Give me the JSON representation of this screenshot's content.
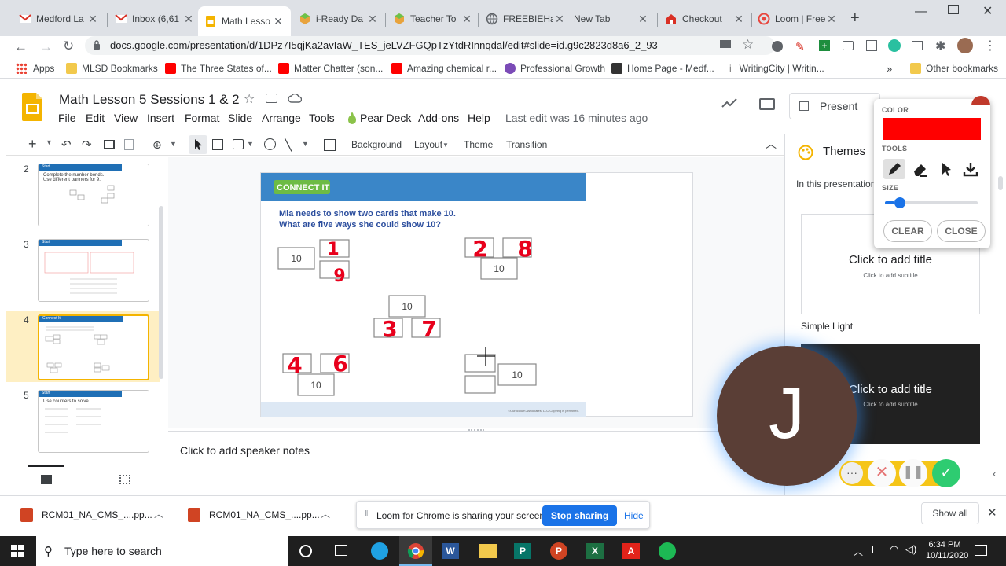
{
  "tabs": [
    {
      "title": "Medford La",
      "icon": "gmail-icon"
    },
    {
      "title": "Inbox (6,61",
      "icon": "gmail-icon"
    },
    {
      "title": "Math Lesso",
      "icon": "slides-icon",
      "active": true
    },
    {
      "title": "i-Ready Da",
      "icon": "iready-icon"
    },
    {
      "title": "Teacher To",
      "icon": "iready-icon"
    },
    {
      "title": "FREEBIEHa",
      "icon": "globe-icon"
    },
    {
      "title": "New Tab",
      "icon": "none"
    },
    {
      "title": "Checkout",
      "icon": "checkout-icon"
    },
    {
      "title": "Loom | Free",
      "icon": "loom-icon"
    }
  ],
  "url": "docs.google.com/presentation/d/1DPz7I5qjKa2avIaW_TES_jeLVZFGQpTzYtdRInnqdal/edit#slide=id.g9c2823d8a6_2_93",
  "bookmarks": [
    {
      "label": "Apps",
      "color": "#4285f4"
    },
    {
      "label": "MLSD Bookmarks",
      "color": "#f2c94c"
    },
    {
      "label": "The Three States of...",
      "color": "#ff0000"
    },
    {
      "label": "Matter Chatter (son...",
      "color": "#ff0000"
    },
    {
      "label": "Amazing chemical r...",
      "color": "#ff0000"
    },
    {
      "label": "Professional Growth",
      "color": "#7b4bb7"
    },
    {
      "label": "Home Page - Medf...",
      "color": "#333333"
    },
    {
      "label": "WritingCity | Writin...",
      "color": "#777777"
    }
  ],
  "other_bookmarks": "Other bookmarks",
  "doc": {
    "title": "Math Lesson 5 Sessions 1 & 2",
    "menus": [
      "File",
      "Edit",
      "View",
      "Insert",
      "Format",
      "Slide",
      "Arrange",
      "Tools",
      "Pear Deck",
      "Add-ons",
      "Help"
    ],
    "last_edit": "Last edit was 16 minutes ago",
    "present": "Present"
  },
  "editbar": {
    "background": "Background",
    "layout": "Layout",
    "theme": "Theme",
    "transition": "Transition"
  },
  "thumbs": [
    {
      "num": "2",
      "header": "Start",
      "line1": "Complete the number bonds.",
      "line2": "Use different partners for 9."
    },
    {
      "num": "3",
      "header": "Start"
    },
    {
      "num": "4",
      "header": "Connect It",
      "selected": true
    },
    {
      "num": "5",
      "header": "Start",
      "line1": "Use counters to solve."
    }
  ],
  "slide": {
    "banner": "CONNECT IT",
    "q1": "Mia needs to show two cards that make 10.",
    "q2": "What are five ways she could show 10?",
    "ten": "10",
    "handwritten": [
      "1",
      "9",
      "2",
      "8",
      "3",
      "7",
      "4",
      "6"
    ],
    "footer": "©Curriculum Associates, LLC   Copying is permitted."
  },
  "notes": "Click to add speaker notes",
  "themes": {
    "title": "Themes",
    "in_this": "In this presentation",
    "card_title": "Click to add title",
    "card_sub": "Click to add subtitle",
    "simple_light": "Simple Light"
  },
  "loom": {
    "color_label": "COLOR",
    "color": "#ff0000",
    "tools_label": "TOOLS",
    "size_label": "SIZE",
    "size_value": 0.1,
    "clear": "CLEAR",
    "close": "CLOSE",
    "camera_letter": "J"
  },
  "download_bar": {
    "file1": "RCM01_NA_CMS_....pp...",
    "file2": "RCM01_NA_CMS_....pp...",
    "sharing": "Loom for Chrome is sharing your screen.",
    "stop": "Stop sharing",
    "hide": "Hide",
    "show_all": "Show all"
  },
  "taskbar": {
    "search": "Type here to search",
    "time": "6:34 PM",
    "date": "10/11/2020"
  }
}
